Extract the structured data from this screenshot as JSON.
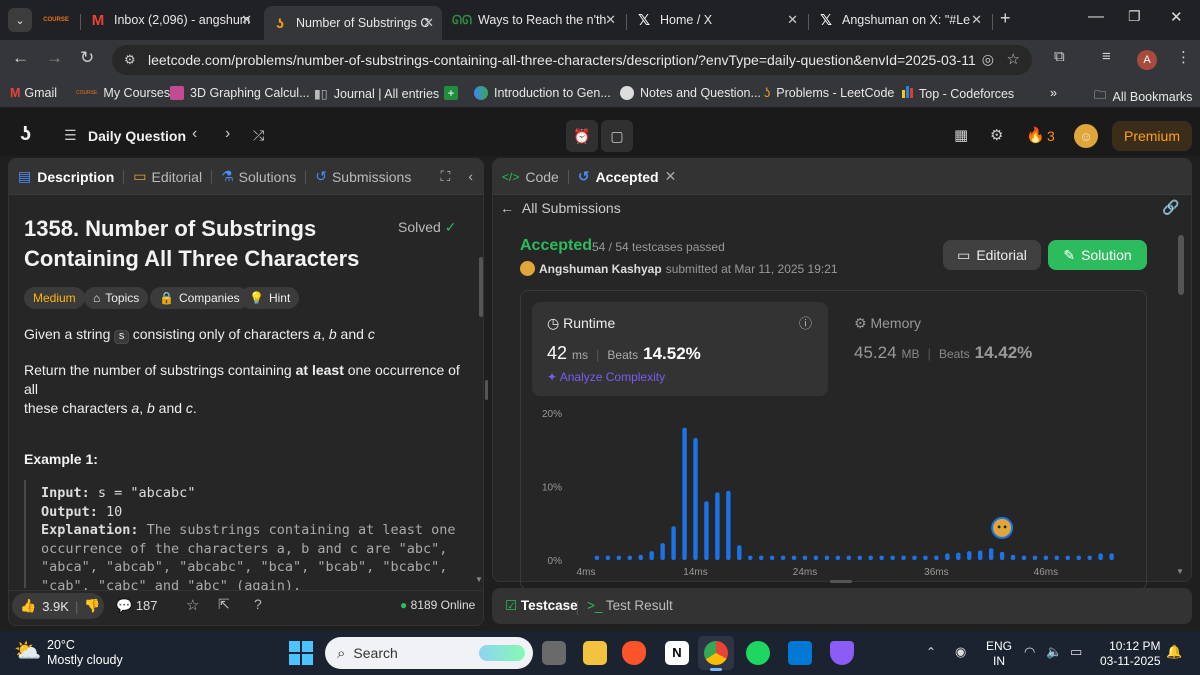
{
  "browser": {
    "tabs": [
      {
        "title": "",
        "icon": "coursera-icon",
        "color": "#e8711a"
      },
      {
        "title": "Inbox (2,096) - angshum",
        "icon": "gmail-icon",
        "color": "#ea4335"
      },
      {
        "title": "Number of Substrings C",
        "icon": "leetcode-icon",
        "color": "#f89f1b",
        "active": true
      },
      {
        "title": "Ways to Reach the n'th",
        "icon": "gfg-icon",
        "color": "#2f8d46"
      },
      {
        "title": "Home / X",
        "icon": "x-icon",
        "color": "#ffffff"
      },
      {
        "title": "Angshuman on X: \"#Le",
        "icon": "x-icon",
        "color": "#ffffff"
      }
    ],
    "url": "leetcode.com/problems/number-of-substrings-containing-all-three-characters/description/?envType=daily-question&envId=2025-03-11",
    "profile_initial": "A",
    "bookmarks": [
      "Gmail",
      "My Courses",
      "3D Graphing Calcul...",
      "Journal | All entries",
      "Introduction to Gen...",
      "Notes and Question...",
      "Problems - LeetCode",
      "Top - Codeforces"
    ],
    "all_bookmarks": "All Bookmarks",
    "more": "»"
  },
  "header": {
    "daily": "Daily Question",
    "streak": "3",
    "premium": "Premium"
  },
  "left": {
    "tabs": [
      "Description",
      "Editorial",
      "Solutions",
      "Submissions"
    ],
    "title_line1": "1358. Number of Substrings",
    "title_line2": "Containing All Three Characters",
    "solved": "Solved",
    "tags": [
      "Medium",
      "Topics",
      "Companies",
      "Hint"
    ],
    "p1_a": "Given a string ",
    "p1_code": "s",
    "p1_b": " consisting only of characters ",
    "p1_c": "a",
    ", ": ", ",
    "p1_d": "b",
    "and": " and ",
    "p1_e": "c",
    ".": ".",
    "p2_a": "Return the number of substrings containing ",
    "p2_bold": "at least",
    "p2_b": " one occurrence of all",
    "p2_c": "these characters ",
    "p2_d": "a",
    "p2_e": "b",
    "p2_and": " and ",
    "p2_f": "c",
    "dot": ".",
    "example_title": "Example 1:",
    "input_label": "Input:",
    "input_val": " s = \"abcabc\"",
    "output_label": "Output:",
    "output_val": " 10",
    "expl_label": "Explanation:",
    "expl_l1": " The substrings containing at least one",
    "expl_l2": "occurrence of the characters a, b and c are \"abc\",",
    "expl_l3": "\"abca\", \"abcab\", \"abcabc\", \"bca\", \"bcab\", \"bcabc\",",
    "expl_l4": "\"cab\", \"cabc\" and \"abc\" (again).",
    "likes": "3.9K",
    "comments": "187",
    "online": "8189 Online"
  },
  "right": {
    "tab_code": "Code",
    "tab_accepted": "Accepted",
    "back": "All Submissions",
    "status": "Accepted",
    "testcases": "54 / 54 testcases passed",
    "user": "Angshuman Kashyap",
    "submitted": "submitted at Mar 11, 2025 19:21",
    "editorial_btn": "Editorial",
    "solution_btn": "Solution",
    "runtime_label": "Runtime",
    "runtime_val": "42",
    "runtime_unit": "ms",
    "beats": "Beats",
    "runtime_beats": "14.52%",
    "analyze": "Analyze Complexity",
    "memory_label": "Memory",
    "memory_val": "45.24",
    "memory_unit": "MB",
    "memory_beats": "14.42%",
    "testcase": "Testcase",
    "test_result": "Test Result"
  },
  "chart_data": {
    "type": "bar",
    "y_ticks": [
      "20%",
      "10%",
      "0%"
    ],
    "ylim": [
      0,
      20
    ],
    "x_ticks": [
      "4ms",
      "14ms",
      "24ms",
      "36ms",
      "46ms"
    ],
    "x_tick_values": [
      4,
      14,
      24,
      36,
      46
    ],
    "x": [
      5,
      6,
      7,
      8,
      9,
      10,
      11,
      12,
      13,
      14,
      15,
      16,
      17,
      18,
      19,
      20,
      21,
      22,
      23,
      24,
      25,
      26,
      27,
      28,
      29,
      30,
      31,
      32,
      33,
      34,
      35,
      36,
      37,
      38,
      39,
      40,
      41,
      42,
      43,
      44,
      45,
      46,
      47,
      48,
      49,
      50,
      51,
      52
    ],
    "values": [
      0.6,
      0.6,
      0.6,
      0.6,
      0.7,
      1.2,
      2.3,
      4.6,
      18.0,
      16.6,
      8.0,
      9.2,
      9.4,
      2.0,
      0.6,
      0.6,
      0.6,
      0.6,
      0.6,
      0.6,
      0.6,
      0.6,
      0.6,
      0.6,
      0.6,
      0.6,
      0.6,
      0.6,
      0.6,
      0.6,
      0.6,
      0.6,
      0.9,
      1.0,
      1.2,
      1.3,
      1.6,
      1.1,
      0.7,
      0.6,
      0.6,
      0.6,
      0.6,
      0.6,
      0.6,
      0.6,
      0.9,
      0.9
    ],
    "highlight_x": 42,
    "color": "#1a73e8"
  },
  "taskbar": {
    "temp": "20°C",
    "weather": "Mostly cloudy",
    "search": "Search",
    "lang1": "ENG",
    "lang2": "IN",
    "time": "10:12 PM",
    "date": "03-11-2025"
  }
}
